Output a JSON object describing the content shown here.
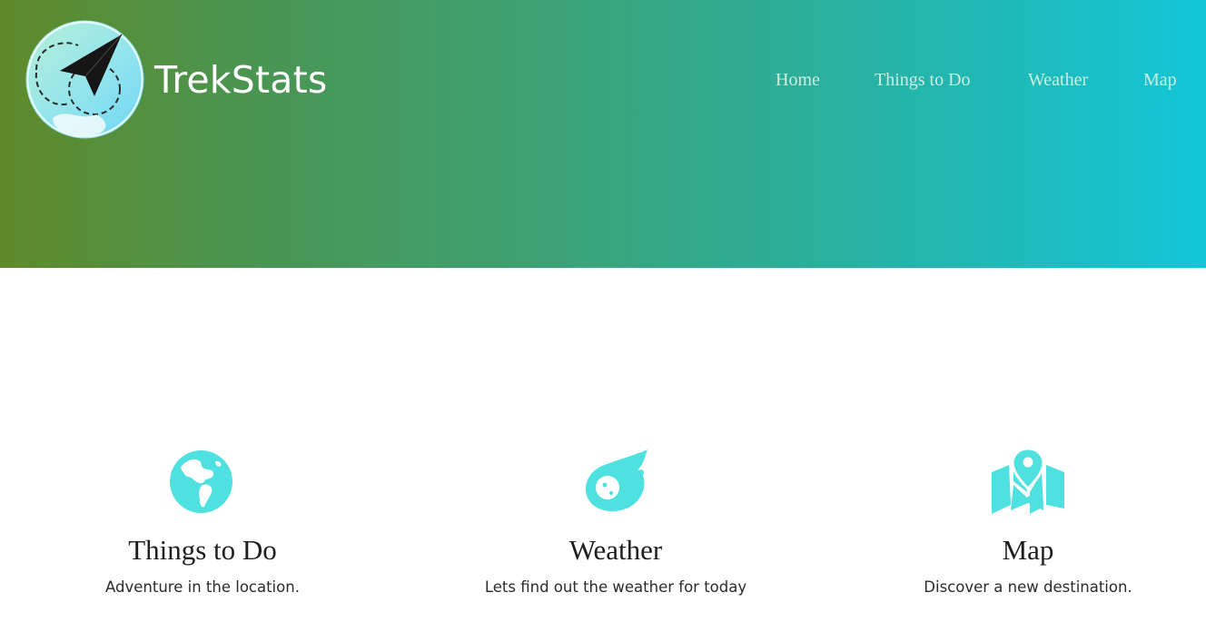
{
  "brand": {
    "name": "TrekStats",
    "logo_icon": "paper-plane-globe-logo"
  },
  "nav": {
    "items": [
      {
        "label": "Home"
      },
      {
        "label": "Things to Do"
      },
      {
        "label": "Weather"
      },
      {
        "label": "Map"
      }
    ]
  },
  "features": [
    {
      "icon": "globe-icon",
      "title": "Things to Do",
      "description": "Adventure in the location."
    },
    {
      "icon": "meteor-icon",
      "title": "Weather",
      "description": "Lets find out the weather for today"
    },
    {
      "icon": "map-pin-icon",
      "title": "Map",
      "description": "Discover a new destination."
    }
  ],
  "colors": {
    "hero_gradient_start": "#5f8a2a",
    "hero_gradient_end": "#13c6d8",
    "nav_link": "#c9f0df",
    "icon_accent": "#4fe0e0",
    "heading_text": "#1e1e1e"
  }
}
